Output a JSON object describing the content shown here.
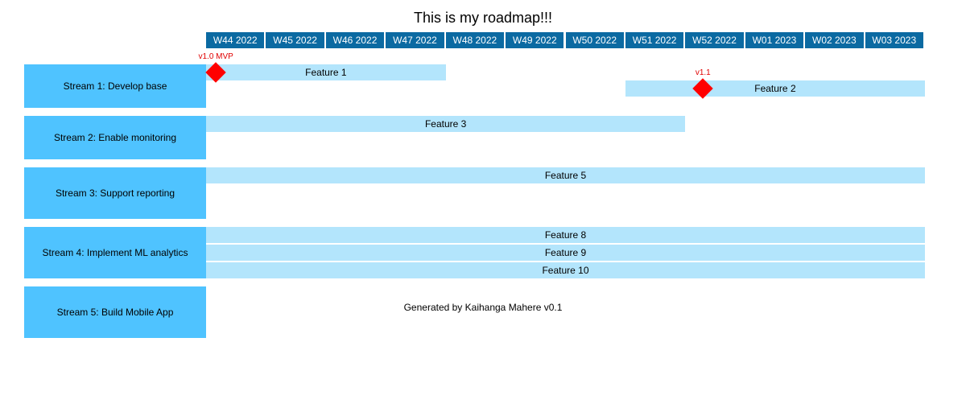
{
  "title": "This is my roadmap!!!",
  "timeline": [
    "W44 2022",
    "W45 2022",
    "W46 2022",
    "W47 2022",
    "W48 2022",
    "W49 2022",
    "W50 2022",
    "W51 2022",
    "W52 2022",
    "W01 2023",
    "W02 2023",
    "W03 2023"
  ],
  "streams": [
    {
      "label": "Stream 1: Develop base"
    },
    {
      "label": "Stream 2: Enable monitoring"
    },
    {
      "label": "Stream 3: Support reporting"
    },
    {
      "label": "Stream 4: Implement ML analytics"
    },
    {
      "label": "Stream 5: Build Mobile App"
    }
  ],
  "features": [
    {
      "label": "Feature 1",
      "stream": 1,
      "start_week": "W44 2022",
      "end_week": "W47 2022"
    },
    {
      "label": "Feature 2",
      "stream": 1,
      "start_week": "W51 2022",
      "end_week": "W03 2023"
    },
    {
      "label": "Feature 3",
      "stream": 2,
      "start_week": "W44 2022",
      "end_week": "W51 2022"
    },
    {
      "label": "Feature 5",
      "stream": 3,
      "start_week": "W44 2022",
      "end_week": "W03 2023"
    },
    {
      "label": "Feature 8",
      "stream": 4,
      "start_week": "W44 2022",
      "end_week": "W03 2023"
    },
    {
      "label": "Feature 9",
      "stream": 4,
      "start_week": "W44 2022",
      "end_week": "W03 2023"
    },
    {
      "label": "Feature 10",
      "stream": 4,
      "start_week": "W44 2022",
      "end_week": "W03 2023"
    }
  ],
  "milestones": [
    {
      "label": "v1.0 MVP",
      "week": "W44 2022"
    },
    {
      "label": "v1.1",
      "week": "W52 2022"
    }
  ],
  "footer": "Generated by Kaihanga Mahere v0.1",
  "colors": {
    "timeline_bg": "#0b6aa2",
    "stream_bg": "#4fc3ff",
    "feature_bg": "#b3e5fc",
    "milestone": "#ff0000"
  }
}
